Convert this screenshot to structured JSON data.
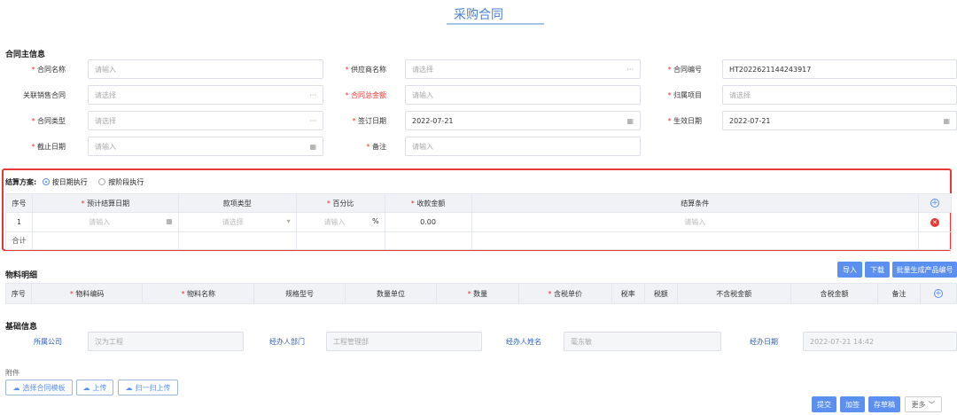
{
  "title": "采购合同",
  "main_section": "合同主信息",
  "fields": {
    "contract_name": {
      "label": "合同名称",
      "placeholder": "请输入"
    },
    "supplier": {
      "label": "供应商名称",
      "placeholder": "请选择",
      "suffix": "···"
    },
    "contract_no": {
      "label": "合同编号",
      "value": "HT2022621144243917"
    },
    "related_sales": {
      "label": "关联销售合同",
      "placeholder": "请选择",
      "suffix": "···"
    },
    "total_amount": {
      "label": "合同总金额",
      "placeholder": "请输入"
    },
    "project": {
      "label": "归属项目",
      "placeholder": "请选择"
    },
    "contract_type": {
      "label": "合同类型",
      "placeholder": "请选择",
      "suffix": "···"
    },
    "sign_date": {
      "label": "签订日期",
      "value": "2022-07-21",
      "suffix": "▦"
    },
    "effective_date": {
      "label": "生效日期",
      "value": "2022-07-21",
      "suffix": "▦"
    },
    "end_date": {
      "label": "截止日期",
      "placeholder": "请输入",
      "suffix": "▦"
    },
    "remark": {
      "label": "备注",
      "placeholder": "请输入"
    }
  },
  "settlement": {
    "label": "结算方案:",
    "options": [
      "按日期执行",
      "按阶段执行"
    ],
    "selected": "按日期执行",
    "headers": [
      "序号",
      "预计结算日期",
      "款项类型",
      "百分比",
      "收款金额",
      "结算条件"
    ],
    "row": {
      "no": "1",
      "date_ph": "请输入",
      "type_ph": "请选择",
      "pct_ph": "请输入",
      "pct_unit": "%",
      "amount": "0.00",
      "cond_ph": "请输入"
    },
    "total_label": "合计"
  },
  "materials": {
    "title": "物料明细",
    "buttons": [
      "导入",
      "下载",
      "批量生成产品编号"
    ],
    "headers": [
      "序号",
      "物料编码",
      "物料名称",
      "规格型号",
      "数量单位",
      "数量",
      "含税单价",
      "税率",
      "税额",
      "不含税金额",
      "含税金额",
      "备注"
    ]
  },
  "basic": {
    "title": "基础信息",
    "company": {
      "label": "所属公司",
      "value": "汉为工程"
    },
    "dept": {
      "label": "经办人部门",
      "value": "工程管理部"
    },
    "person": {
      "label": "经办人姓名",
      "value": "毫东敏"
    },
    "date": {
      "label": "经办日期",
      "value": "2022-07-21 14:42"
    }
  },
  "attachments": {
    "title": "附件",
    "buttons": [
      "选择合同模板",
      "上传",
      "扫一扫上传"
    ]
  },
  "footer": {
    "buttons": [
      "提交",
      "加签",
      "存草稿"
    ],
    "more": "更多"
  }
}
